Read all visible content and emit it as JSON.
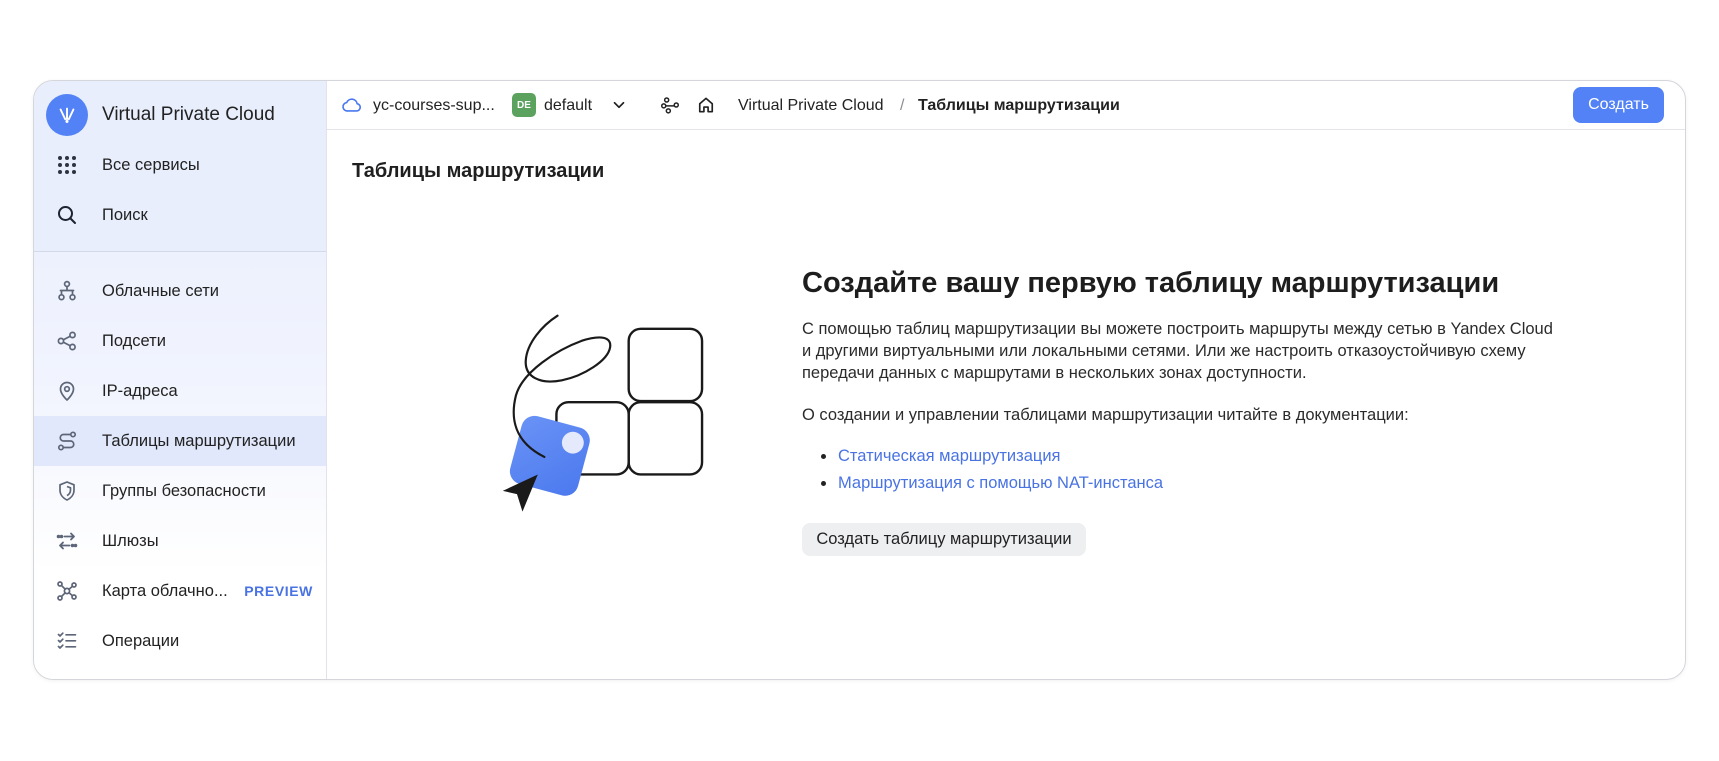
{
  "colors": {
    "primary": "#5282f5",
    "link": "#4973e3",
    "sidebar_bg": "#e8eefc",
    "selected_bg": "#e1e8fb",
    "folder_badge_bg": "#5ba25e",
    "cloud_icon": "#4a78ef"
  },
  "sidebar": {
    "logo_icon": "vpc-logo-icon",
    "app_title": "Virtual Private Cloud",
    "all_services": {
      "label": "Все сервисы",
      "icon": "grid-icon"
    },
    "search": {
      "label": "Поиск",
      "icon": "search-icon"
    },
    "items": [
      {
        "label": "Облачные сети",
        "icon": "cloud-network-icon"
      },
      {
        "label": "Подсети",
        "icon": "subnets-icon"
      },
      {
        "label": "IP-адреса",
        "icon": "ip-address-icon"
      },
      {
        "label": "Таблицы маршрутизации",
        "icon": "route-tables-icon",
        "selected": true
      },
      {
        "label": "Группы безопасности",
        "icon": "shield-icon"
      },
      {
        "label": "Шлюзы",
        "icon": "gateways-icon"
      },
      {
        "label": "Карта облачно...",
        "icon": "cloud-map-icon",
        "badge": "PREVIEW"
      },
      {
        "label": "Операции",
        "icon": "operations-icon"
      }
    ]
  },
  "header": {
    "cloud_icon": "cloud-icon",
    "cloud_name": "yc-courses-sup...",
    "folder_badge": "DE",
    "folder_name": "default",
    "folder_dropdown_icon": "chevron-down-icon",
    "network_icon": "network-icon",
    "home_icon": "home-icon",
    "breadcrumb": [
      "Virtual Private Cloud",
      "Таблицы маршрутизации"
    ],
    "breadcrumb_separator": "/",
    "create_button": "Создать"
  },
  "main": {
    "page_title": "Таблицы маршрутизации",
    "empty_state": {
      "illustration": "empty-routing-illustration",
      "heading": "Создайте вашу первую таблицу маршрутизации",
      "description_lines": [
        "С помощью таблиц маршрутизации вы можете построить маршруты между сетью в Yandex Cloud",
        "и другими виртуальными или локальными сетями. Или же настроить отказоустойчивую схему",
        "передачи данных с маршрутами в нескольких зонах доступности."
      ],
      "docs_intro": "О создании и управлении таблицами маршрутизации читайте в документации:",
      "links": [
        "Статическая маршрутизация",
        "Маршрутизация с помощью NAT-инстанса"
      ],
      "create_button": "Создать таблицу маршрутизации"
    }
  }
}
